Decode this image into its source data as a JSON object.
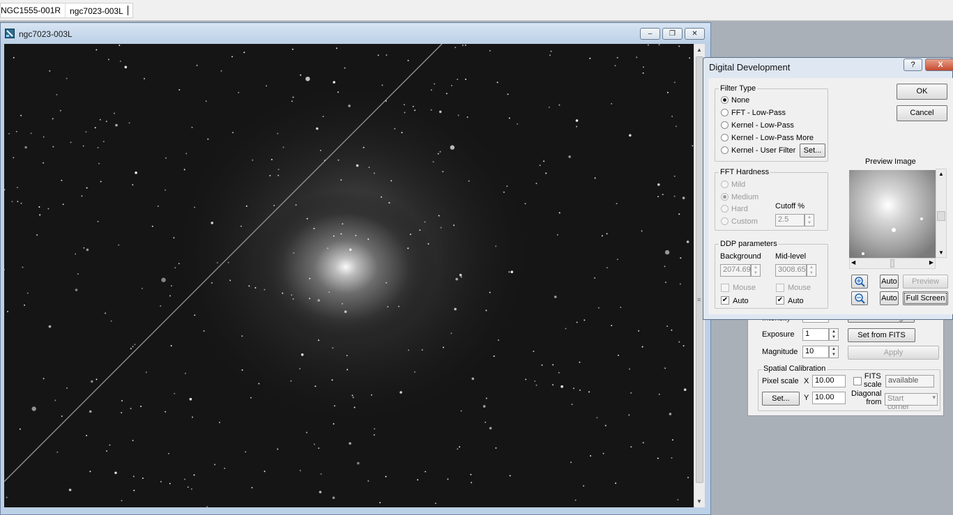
{
  "tabs": [
    "NGC1555-001R",
    "ngc7023-003L"
  ],
  "image_window": {
    "title": "ngc7023-003L",
    "minimize": "–",
    "restore": "❐",
    "close": "✕"
  },
  "properties_panel": {
    "intensity_label": "Intensity",
    "intensity_button": "Set from Image",
    "exposure_label": "Exposure",
    "exposure_value": "1",
    "set_from_fits": "Set from FITS",
    "magnitude_label": "Magnitude",
    "magnitude_value": "10",
    "apply": "Apply",
    "spatial_title": "Spatial Calibration",
    "pixel_scale_label": "Pixel scale",
    "x_label": "X",
    "x_value": "10.00",
    "y_label": "Y",
    "y_value": "10.00",
    "set_button": "Set...",
    "fits_scale_label_1": "FITS",
    "fits_scale_label_2": "scale",
    "available": "available",
    "diagonal_label_1": "Diagonal",
    "diagonal_label_2": "from",
    "start_corner": "Start corner"
  },
  "dialog": {
    "title": "Digital Development",
    "help": "?",
    "close": "X",
    "ok": "OK",
    "cancel": "Cancel",
    "filter_type_title": "Filter Type",
    "filter_options": [
      "None",
      "FFT - Low-Pass",
      "Kernel - Low-Pass",
      "Kernel - Low-Pass More",
      "Kernel - User Filter"
    ],
    "filter_selected": "None",
    "filter_set_button": "Set...",
    "fft_hardness_title": "FFT Hardness",
    "hardness_options": [
      "Mild",
      "Medium",
      "Hard",
      "Custom"
    ],
    "hardness_selected": "Medium",
    "cutoff_label": "Cutoff %",
    "cutoff_value": "2.5",
    "ddp_title": "DDP parameters",
    "background_label": "Background",
    "background_value": "2074.69",
    "midlevel_label": "Mid-level",
    "midlevel_value": "3008.65",
    "mouse_label": "Mouse",
    "auto_label": "Auto",
    "preview_title": "Preview Image",
    "preview_button": "Preview",
    "fullscreen_button": "Full Screen",
    "zoom_in_auto": "Auto",
    "zoom_out_auto": "Auto"
  }
}
